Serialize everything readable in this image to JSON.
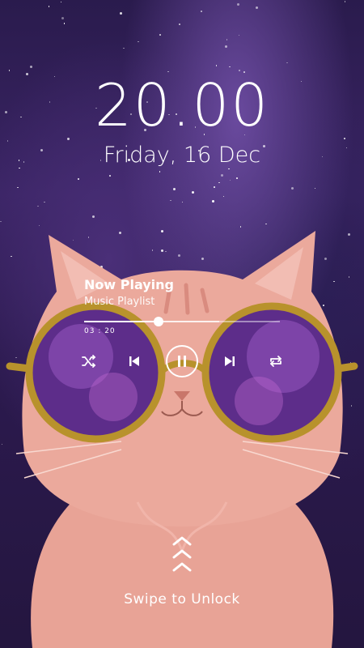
{
  "lockscreen": {
    "time": "20.00",
    "date": "Friday, 16 Dec"
  },
  "player": {
    "title": "Now Playing",
    "subtitle": "Music Playlist",
    "elapsed": "03 : 20",
    "progress_fraction": 0.38,
    "buffered_fraction": 0.69
  },
  "controls": [
    "shuffle-icon",
    "previous-icon",
    "pause-icon",
    "next-icon",
    "repeat-icon"
  ],
  "unlock": {
    "label": "Swipe to Unlock"
  },
  "colors": {
    "text": "#ffffff",
    "sky": "#2a1b4d",
    "cat": "#e9a59a",
    "glasses": "#b8922c"
  }
}
